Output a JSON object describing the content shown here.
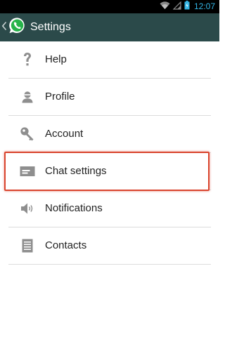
{
  "status_bar": {
    "time": "12:07"
  },
  "action_bar": {
    "title": "Settings"
  },
  "menu": {
    "items": [
      {
        "label": "Help",
        "icon": "help-icon"
      },
      {
        "label": "Profile",
        "icon": "profile-icon"
      },
      {
        "label": "Account",
        "icon": "key-icon"
      },
      {
        "label": "Chat settings",
        "icon": "chat-icon",
        "highlighted": true
      },
      {
        "label": "Notifications",
        "icon": "speaker-icon"
      },
      {
        "label": "Contacts",
        "icon": "contacts-icon"
      }
    ]
  },
  "colors": {
    "action_bar": "#2b4a4a",
    "status_time": "#33b5e5",
    "highlight": "#d9442e",
    "divider": "#dcdcdc"
  }
}
